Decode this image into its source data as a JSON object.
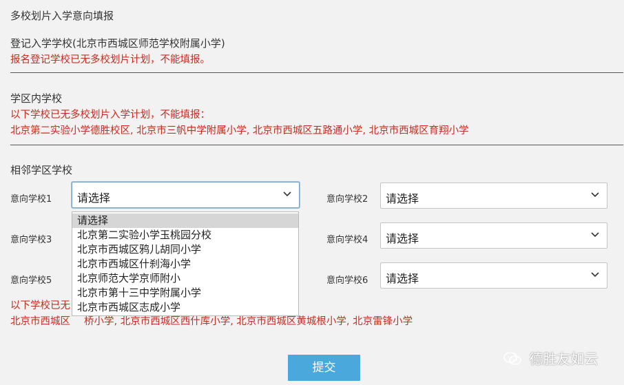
{
  "page_title": "多校划片入学意向填报",
  "registered": {
    "heading": "登记入学学校(北京市西城区师范学校附属小学)",
    "warning": "报名登记学校已无多校划片计划，不能填报。"
  },
  "district": {
    "heading": "学区内学校",
    "warning_line1": "以下学校已无多校划片入学计划，不能填报：",
    "warning_line2": "北京第二实验小学德胜校区, 北京市三帆中学附属小学, 北京市西城区五路通小学, 北京市西城区育翔小学"
  },
  "adjacent": {
    "heading": "相邻学区学校",
    "fields": [
      {
        "label": "意向学校1",
        "value": "请选择"
      },
      {
        "label": "意向学校2",
        "value": "请选择"
      },
      {
        "label": "意向学校3",
        "value": ""
      },
      {
        "label": "意向学校4",
        "value": "请选择"
      },
      {
        "label": "意向学校5",
        "value": ""
      },
      {
        "label": "意向学校6",
        "value": "请选择"
      }
    ],
    "dropdown_options": [
      "请选择",
      "北京第二实验小学玉桃园分校",
      "北京市西城区鸦儿胡同小学",
      "北京市西城区什刹海小学",
      "北京师范大学京师附小",
      "北京市第十三中学附属小学",
      "北京市西城区志成小学"
    ],
    "warning_line1_visible": "以下学校已无",
    "warning_line2_visible_a": "北京市西城区",
    "warning_line2_visible_b": "桥小学, 北京市西城区西什库小学, 北京市西城区黄城根小学, 北京雷锋小学"
  },
  "submit_label": "提交",
  "watermark": "德胜友如云",
  "colors": {
    "warning": "#cc2a1f",
    "button": "#4aa8dc",
    "focus": "#7aa7c9"
  },
  "icons": {
    "chevron": "chevron-down-icon",
    "watermark": "wechat-icon"
  }
}
